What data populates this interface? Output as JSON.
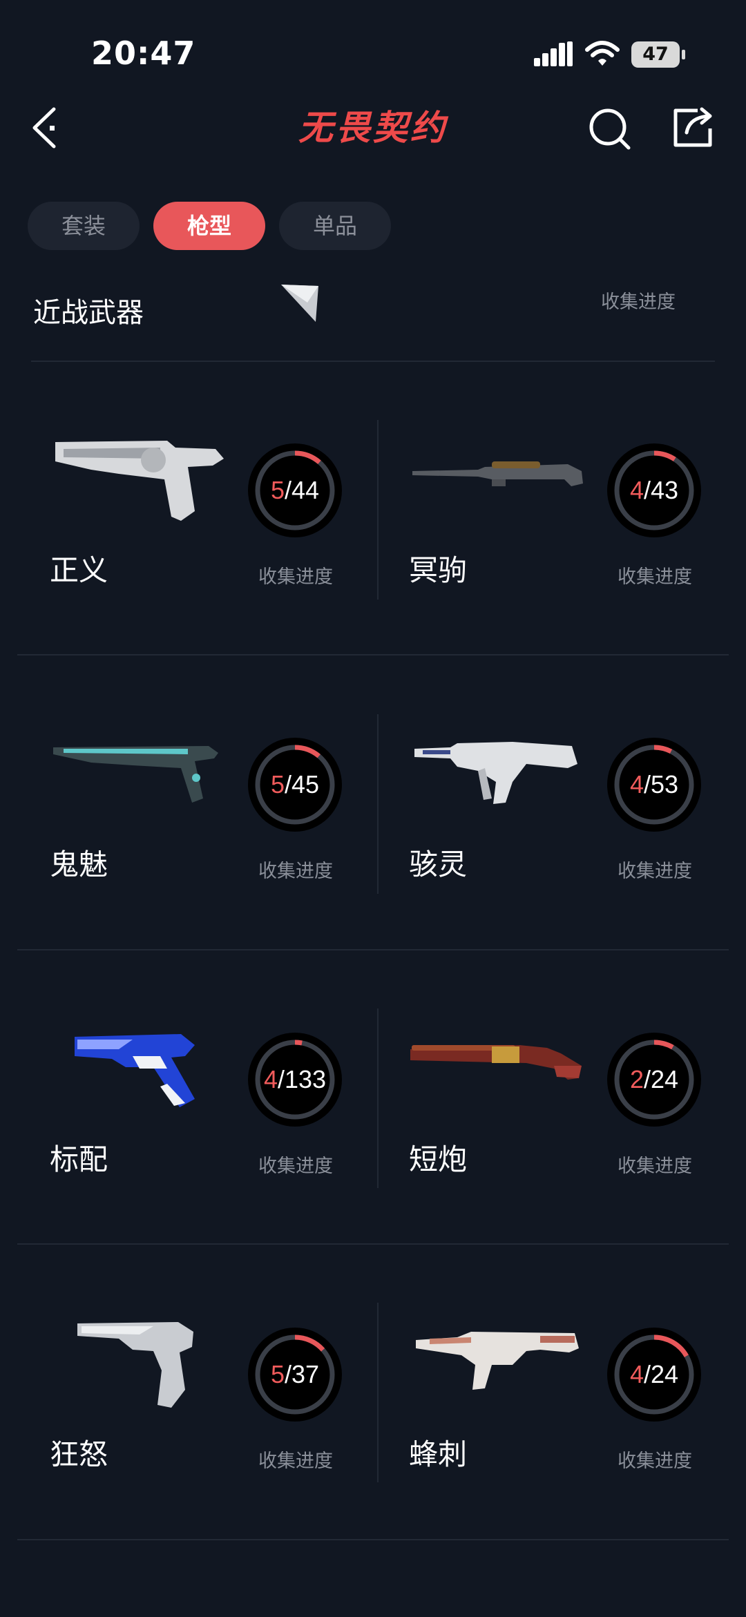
{
  "status_bar": {
    "time": "20:47",
    "battery": "47"
  },
  "header": {
    "title": "无畏契约",
    "icons": [
      "back-arrow-icon",
      "search-icon",
      "share-icon"
    ]
  },
  "tabs": [
    {
      "label": "套装",
      "active": false
    },
    {
      "label": "枪型",
      "active": true
    },
    {
      "label": "单品",
      "active": false
    }
  ],
  "section": {
    "title": "近战武器",
    "progress_label": "收集进度"
  },
  "weapons": [
    {
      "name": "正义",
      "owned": "5",
      "total": "44",
      "progress_label": "收集进度",
      "fraction": 0.114
    },
    {
      "name": "冥驹",
      "owned": "4",
      "total": "43",
      "progress_label": "收集进度",
      "fraction": 0.093
    },
    {
      "name": "鬼魅",
      "owned": "5",
      "total": "45",
      "progress_label": "收集进度",
      "fraction": 0.111
    },
    {
      "name": "骇灵",
      "owned": "4",
      "total": "53",
      "progress_label": "收集进度",
      "fraction": 0.075
    },
    {
      "name": "标配",
      "owned": "4",
      "total": "133",
      "progress_label": "收集进度",
      "fraction": 0.03
    },
    {
      "name": "短炮",
      "owned": "2",
      "total": "24",
      "progress_label": "收集进度",
      "fraction": 0.083
    },
    {
      "name": "狂怒",
      "owned": "5",
      "total": "37",
      "progress_label": "收集进度",
      "fraction": 0.135
    },
    {
      "name": "蜂刺",
      "owned": "4",
      "total": "24",
      "progress_label": "收集进度",
      "fraction": 0.167
    }
  ],
  "colors": {
    "accent": "#e8575a",
    "background": "#111722",
    "ring_track": "#3a3f48",
    "ring_fill": "#e8575a"
  }
}
